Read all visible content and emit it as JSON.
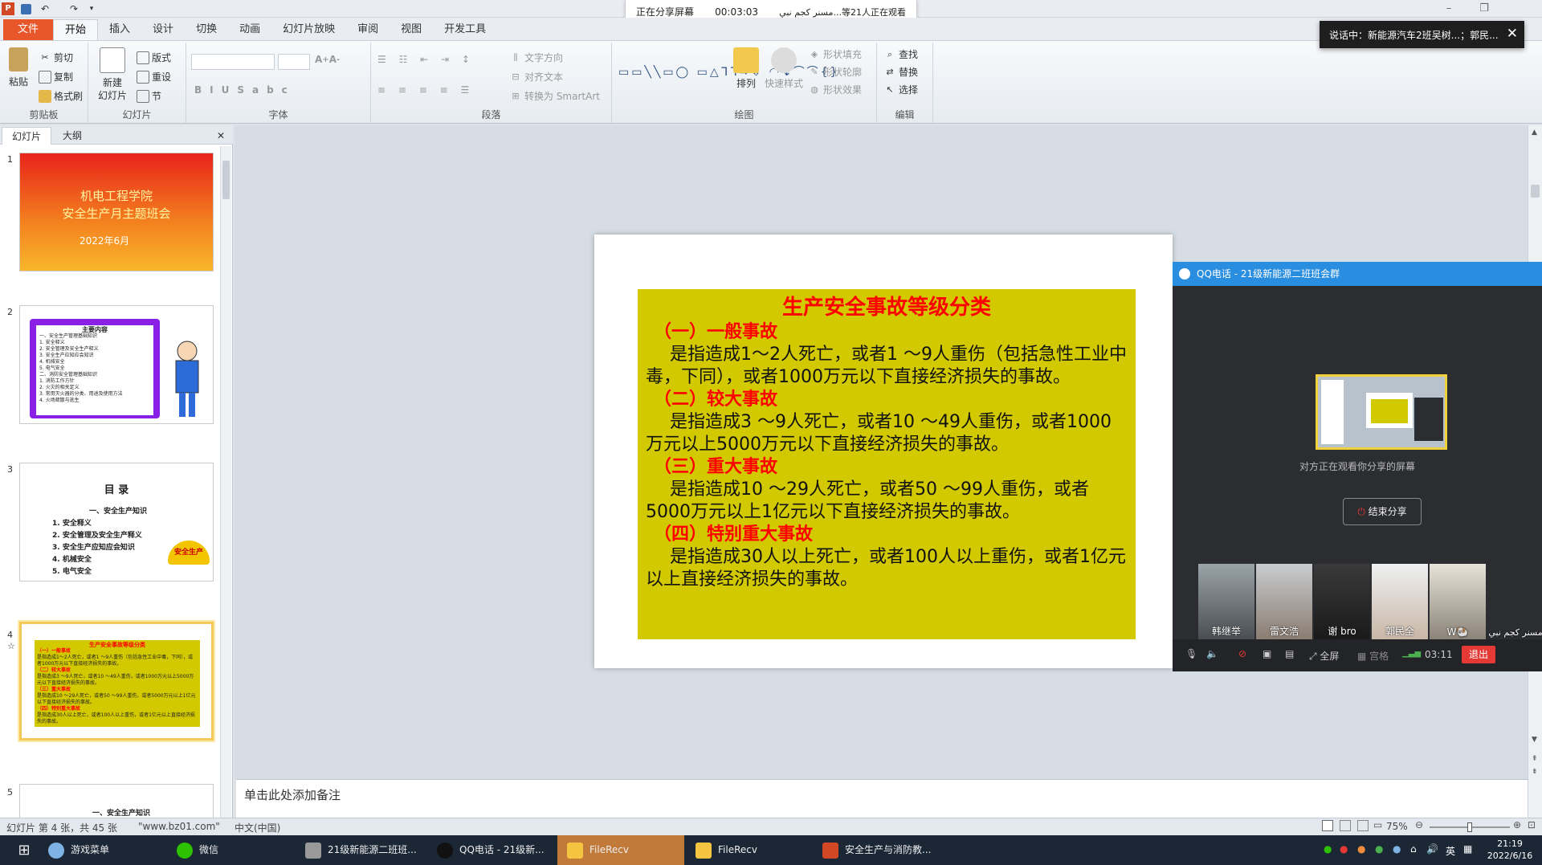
{
  "window": {
    "minimize": "–",
    "maximize": "❐",
    "close": "✕"
  },
  "quick_access": {
    "undo": "↶",
    "redo": "↷"
  },
  "share_banner": {
    "status": "正在分享屏幕",
    "timer": "00:03:03",
    "viewers": "مسنر كجم نبي...等21人正在观看"
  },
  "ribbon_tabs": [
    "文件",
    "开始",
    "插入",
    "设计",
    "切换",
    "动画",
    "幻灯片放映",
    "审阅",
    "视图",
    "开发工具"
  ],
  "ribbon": {
    "clipboard": {
      "paste": "粘贴",
      "cut": "剪切",
      "copy": "复制",
      "format_painter": "格式刷",
      "label": "剪贴板"
    },
    "slides": {
      "new_slide": "新建\n幻灯片",
      "layout": "版式",
      "reset": "重设",
      "section": "节",
      "label": "幻灯片"
    },
    "font": {
      "label": "字体"
    },
    "paragraph": {
      "text_direction": "文字方向",
      "align_text": "对齐文本",
      "smartart": "转换为 SmartArt",
      "label": "段落"
    },
    "drawing": {
      "arrange": "排列",
      "quick_styles": "快速样式",
      "shape_fill": "形状填充",
      "shape_outline": "形状轮廓",
      "shape_effects": "形状效果",
      "label": "绘图"
    },
    "editing": {
      "find": "查找",
      "replace": "替换",
      "select": "选择",
      "label": "编辑"
    }
  },
  "toast": {
    "text": "说话中：新能源汽车2班吴树...；郭民...",
    "close": "✕"
  },
  "left_panel": {
    "tabs": [
      "幻灯片",
      "大纲"
    ],
    "close": "✕",
    "thumbs": [
      {
        "num": "1",
        "title_line1": "机电工程学院",
        "title_line2": "安全生产月主题班会",
        "date": "2022年6月"
      },
      {
        "num": "2",
        "heading": "主要内容",
        "items": [
          "一、安全生产管理基础知识",
          "1. 安全释义",
          "2. 安全管理及安全生产释义",
          "3. 安全生产应知应会知识",
          "4. 机械安全",
          "5. 电气安全",
          "二、消防安全管理基础知识",
          "1. 消防工作方针",
          "2. 火灾的相关定义",
          "3. 常用灭火器的分类、用途及使用方法",
          "4. 火场疏散与逃生"
        ]
      },
      {
        "num": "3",
        "heading": "目 录",
        "sub": "一、安全生产知识",
        "items": [
          "1. 安全释义",
          "2. 安全管理及安全生产释义",
          "3. 安全生产应知应会知识",
          "4. 机械安全",
          "5. 电气安全"
        ],
        "helmet": "安全生产"
      },
      {
        "num": "4",
        "star": "☆"
      },
      {
        "num": "5",
        "sub": "一、安全生产知识"
      }
    ]
  },
  "slide": {
    "title": "生产安全事故等级分类",
    "sections": [
      {
        "heading": "（一）一般事故",
        "body": "是指造成1～2人死亡，或者1 ～9人重伤（包括急性工业中毒，下同），或者1000万元以下直接经济损失的事故。"
      },
      {
        "heading": "（二）较大事故",
        "body": "是指造成3 ～9人死亡，或者10 ～49人重伤，或者1000万元以上5000万元以下直接经济损失的事故。"
      },
      {
        "heading": "（三）重大事故",
        "body": "是指造成10 ～29人死亡，或者50 ～99人重伤，或者5000万元以上1亿元以下直接经济损失的事故。"
      },
      {
        "heading": "（四）特别重大事故",
        "body": "是指造成30人以上死亡，或者100人以上重伤，或者1亿元以上直接经济损失的事故。"
      }
    ]
  },
  "notes": {
    "placeholder": "单击此处添加备注"
  },
  "statusbar": {
    "slide_info": "幻灯片 第 4 张，共 45 张",
    "theme": "\"www.bz01.com\"",
    "language": "中文(中国)",
    "zoom": "75%",
    "zoom_fraction": 0.5
  },
  "qq": {
    "title": "QQ电话 - 21级新能源二班班会群",
    "watching": "对方正在观看你分享的屏幕",
    "end_share": "结束分享",
    "participants": [
      "韩继举",
      "雷文浩",
      "谢 bro",
      "郭民全",
      "W🐏",
      "مسنر كجم نبي"
    ],
    "bar": {
      "fullscreen": "全屏",
      "grid": "宫格",
      "time": "03:11",
      "exit": "退出"
    }
  },
  "taskbar": {
    "items": [
      "游戏菜单",
      "微信",
      "21级新能源二班班...",
      "QQ电话 - 21级新...",
      "FileRecv",
      "FileRecv",
      "安全生产与消防教..."
    ],
    "ime": "英",
    "time": "21:19",
    "date": "2022/6/16"
  },
  "colors": {
    "slide_box": "#d2c900",
    "slide_red": "#ff0000",
    "file_tab": "#e8562a",
    "qq_blue": "#2a8ee0",
    "taskbar": "#1b2735"
  }
}
